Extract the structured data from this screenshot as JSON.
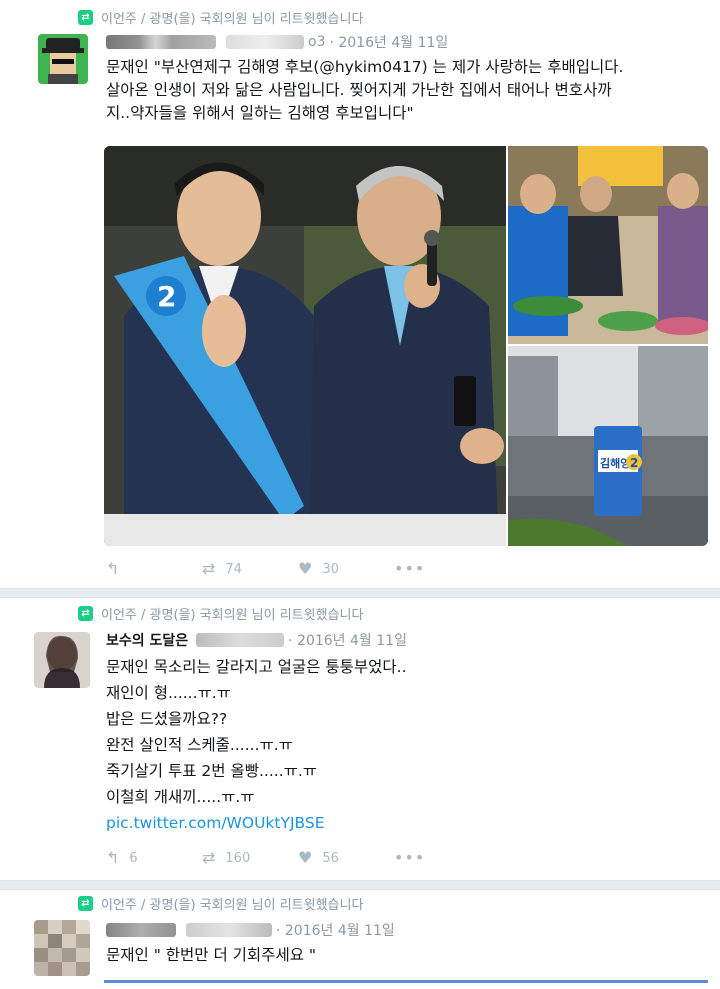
{
  "tweets": [
    {
      "retweet_by": "이언주 / 광명(을) 국회의원 님이 리트윗했습니다",
      "handle_fragment": "o3",
      "date": "· 2016년 4월 11일",
      "text_lines": [
        "문재인 \"부산연제구 김해영 후보(@hykim0417) 는 제가 사랑하는 후배입니다.",
        "살아온 인생이 저와 닮은 사람입니다. 찢어지게 가난한 집에서 태어나 변호사까",
        "지..약자들을 위해서 일하는 김해영 후보입니다\""
      ],
      "retweets": "74",
      "likes": "30",
      "photo_sash_number": "2",
      "photo_sign_name": "김해영",
      "photo_sign_number": "2"
    },
    {
      "retweet_by": "이언주 / 광명(을) 국회의원 님이 리트윗했습니다",
      "name": "보수의 도달은",
      "handle_fragment": "",
      "date": "· 2016년 4월 11일",
      "text_lines": [
        "문재인 목소리는 갈라지고 얼굴은 퉁퉁부었다..",
        "재인이 형......ㅠ.ㅠ",
        "밥은 드셨을까요??",
        "완전 살인적 스케줄......ㅠ.ㅠ",
        "죽기살기 투표 2번 올빵.....ㅠ.ㅠ",
        "이철희 개새끼.....ㅠ.ㅠ"
      ],
      "link": "pic.twitter.com/WOUktYJBSE",
      "replies": "6",
      "retweets": "160",
      "likes": "56"
    },
    {
      "retweet_by": "이언주 / 광명(을) 국회의원 님이 리트윗했습니다",
      "date": "· 2016년 4월 11일",
      "text_lines": [
        "문재인  \" 한번만 더 기회주세요 \""
      ]
    }
  ],
  "icons": {
    "reply": "reply-icon",
    "retweet": "retweet-icon",
    "like": "heart-icon",
    "more": "more-icon"
  },
  "colors": {
    "retweet_green": "#19cf86",
    "link_blue": "#1b95e0",
    "meta_gray": "#8899a6",
    "campaign_blue": "#1a7bd0"
  }
}
